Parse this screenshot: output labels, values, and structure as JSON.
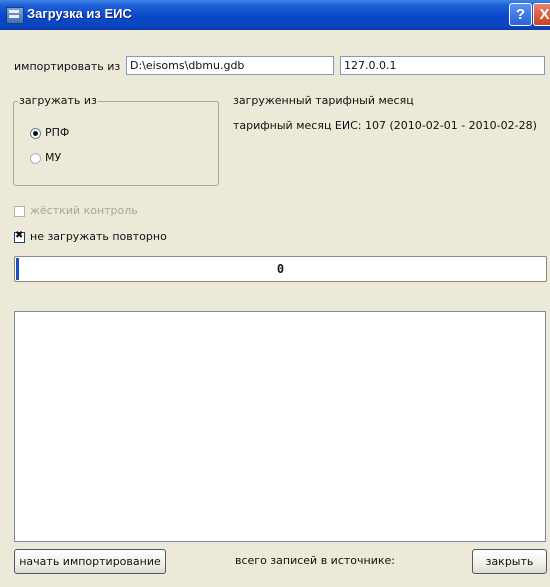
{
  "window": {
    "title": "Загрузка из ЕИС",
    "help_label": "?",
    "close_label": "X"
  },
  "import": {
    "label": "импортировать из",
    "path_value": "D:\\eisoms\\dbmu.gdb",
    "host_value": "127.0.0.1"
  },
  "load_from": {
    "legend": "загружать из",
    "options": [
      {
        "label": "РПФ",
        "selected": true
      },
      {
        "label": "МУ",
        "selected": false
      }
    ]
  },
  "tariff": {
    "heading": "загруженный тарифный месяц",
    "eis_month": "тарифный месяц ЕИС: 107 (2010-02-01 - 2010-02-28)"
  },
  "options": {
    "strict_control": {
      "label": "жёсткий контроль",
      "checked": false,
      "enabled": false
    },
    "no_reload": {
      "label": "не загружать повторно",
      "checked": true,
      "enabled": true
    }
  },
  "progress": {
    "text": "0"
  },
  "footer": {
    "start_label": "начать импортирование",
    "records_label": "всего записей в источнике:",
    "close_label": "закрыть"
  }
}
